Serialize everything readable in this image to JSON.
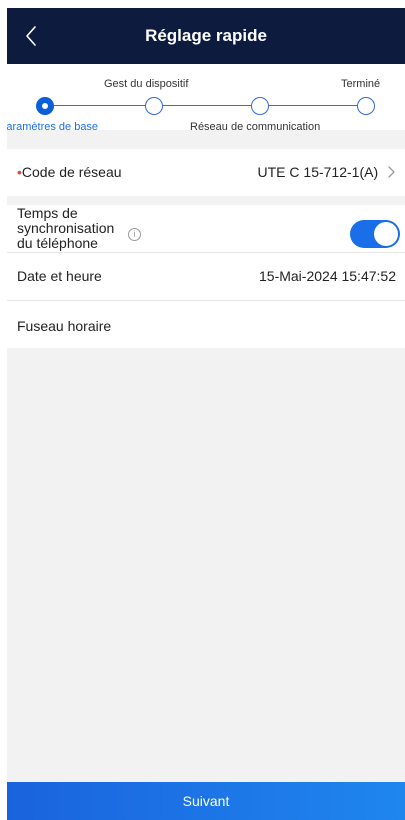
{
  "header": {
    "title": "Réglage rapide",
    "back_icon": "chevron-left-icon"
  },
  "stepper": {
    "steps": [
      {
        "label": "Paramètres de base",
        "state": "active"
      },
      {
        "label": "Gest du dispositif",
        "state": "pending"
      },
      {
        "label": "Réseau de communication",
        "state": "pending"
      },
      {
        "label": "Terminé",
        "state": "pending"
      }
    ]
  },
  "settings": {
    "grid_code": {
      "required_mark": "•",
      "label": "Code de réseau",
      "value": "UTE C 15-712-1(A)"
    },
    "time_sync": {
      "label_line1": "Temps de",
      "label_line2": "synchronisation",
      "label_line3": "du téléphone",
      "info_icon": "info-icon",
      "enabled": true
    },
    "date_time": {
      "label": "Date et heure",
      "value": "15-Mai-2024 15:47:52"
    },
    "timezone": {
      "label": "Fuseau horaire",
      "value": ""
    }
  },
  "footer": {
    "next_label": "Suivant"
  },
  "colors": {
    "header_bg": "#0d1b3e",
    "accent": "#1a6ee8",
    "required": "#e0473b",
    "page_bg": "#f2f2f2"
  }
}
